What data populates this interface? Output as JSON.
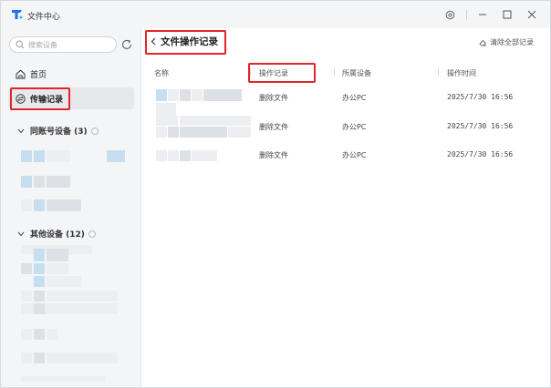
{
  "app": {
    "title": "文件中心",
    "brand_color": "#1a73e8"
  },
  "sidebar": {
    "search_placeholder": "搜索设备",
    "nav": [
      {
        "label": "首页",
        "icon": "home-icon",
        "active": false
      },
      {
        "label": "传输记录",
        "icon": "transfer-record-icon",
        "active": true
      }
    ],
    "groups": [
      {
        "label": "同账号设备 (3)",
        "expanded": true
      },
      {
        "label": "其他设备 (12)",
        "expanded": true
      }
    ]
  },
  "main": {
    "title": "文件操作记录",
    "clear_all_label": "清除全部记录",
    "columns": [
      "名称",
      "操作记录",
      "所属设备",
      "操作时间"
    ],
    "rows": [
      {
        "name": "",
        "action": "删除文件",
        "device": "办公PC",
        "time": "2025/7/30 16:56"
      },
      {
        "name": "",
        "action": "删除文件",
        "device": "办公PC",
        "time": "2025/7/30 16:56"
      },
      {
        "name": "",
        "action": "删除文件",
        "device": "办公PC",
        "time": "2025/7/30 16:56"
      }
    ]
  },
  "colors": {
    "highlight_box": "#e0262a",
    "active_nav_bg": "#e6e8ec",
    "sidebar_bg": "#f4f5f7"
  }
}
